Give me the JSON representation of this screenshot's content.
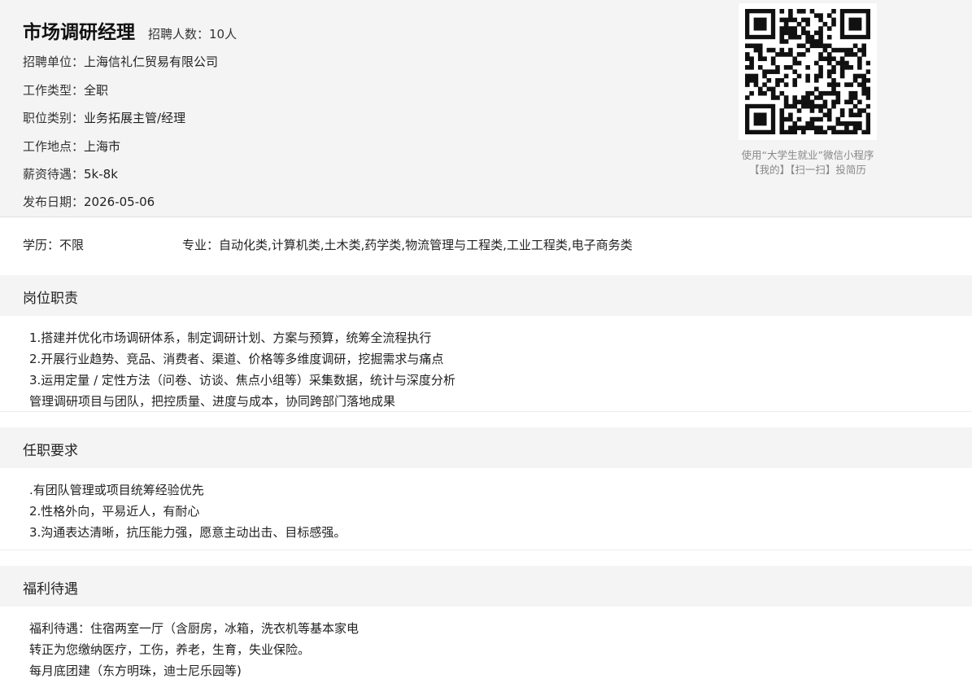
{
  "job": {
    "title": "市场调研经理",
    "headcount": "招聘人数：10人",
    "fields": [
      {
        "label": "招聘单位：",
        "value": "上海信礼仁贸易有限公司"
      },
      {
        "label": "工作类型：",
        "value": "全职"
      },
      {
        "label": "职位类别：",
        "value": "业务拓展主管/经理"
      },
      {
        "label": "工作地点：",
        "value": "上海市"
      },
      {
        "label": "薪资待遇：",
        "value": "5k-8k"
      },
      {
        "label": "发布日期：",
        "value": "2026-05-06"
      }
    ]
  },
  "qr": {
    "caption_line1": "使用“大学生就业”微信小程序",
    "caption_line2": "【我的】【扫一扫】投简历"
  },
  "requirements": {
    "education": "学历：不限",
    "major": "专业：自动化类,计算机类,土木类,药学类,物流管理与工程类,工业工程类,电子商务类"
  },
  "sections": [
    {
      "title": "岗位职责",
      "lines": [
        "1.搭建并优化市场调研体系，制定调研计划、方案与预算，统筹全流程执行",
        "2.开展行业趋势、竞品、消费者、渠道、价格等多维度调研，挖掘需求与痛点",
        "3.运用定量 / 定性方法（问卷、访谈、焦点小组等）采集数据，统计与深度分析",
        "管理调研项目与团队，把控质量、进度与成本，协同跨部门落地成果"
      ]
    },
    {
      "title": "任职要求",
      "lines": [
        ".有团队管理或项目统筹经验优先",
        "2.性格外向，平易近人，有耐心",
        "3.沟通表达清晰，抗压能力强，愿意主动出击、目标感强。"
      ]
    },
    {
      "title": "福利待遇",
      "lines": [
        "福利待遇：住宿两室一厅（含厨房，冰箱，洗衣机等基本家电",
        "转正为您缴纳医疗，工伤，养老，生育，失业保险。",
        "每月底团建（东方明珠，迪士尼乐园等)"
      ]
    }
  ]
}
